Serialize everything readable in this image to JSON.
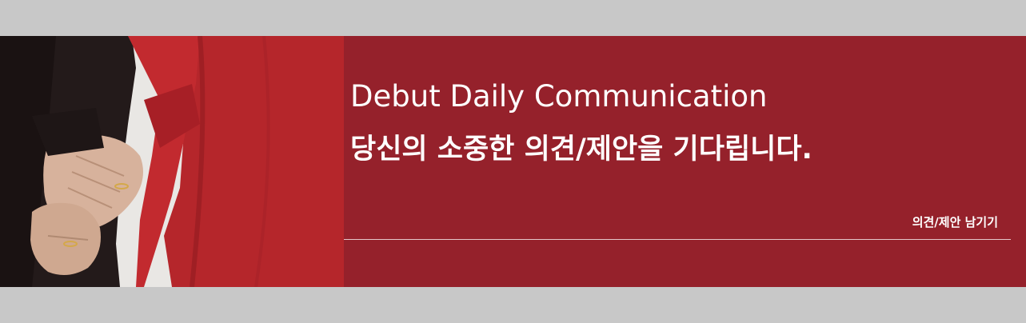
{
  "banner": {
    "subtitle_en": "Debut Daily Communication",
    "headline_ko": "당신의 소중한 의견/제안을 기다립니다.",
    "cta_label": "의견/제안 남기기"
  },
  "colors": {
    "banner_background": "#95212b",
    "page_background": "#c8c8c8",
    "text": "#ffffff"
  },
  "image": {
    "description_name": "holding-hands-photo"
  }
}
